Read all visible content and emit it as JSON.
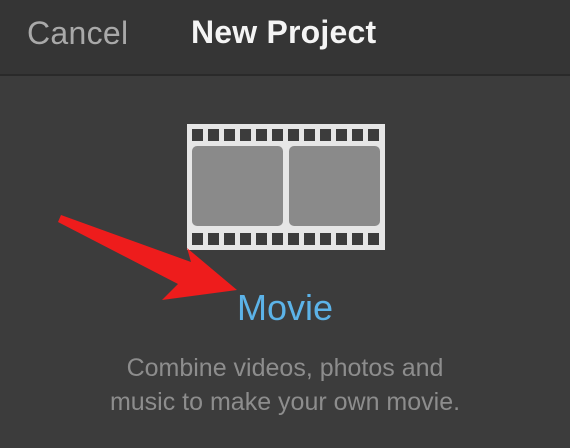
{
  "header": {
    "cancel_label": "Cancel",
    "title": "New Project"
  },
  "project_option": {
    "icon": "film-strip-icon",
    "label": "Movie",
    "description_line1": "Combine videos, photos and",
    "description_line2": "music to make your own movie."
  },
  "annotation": {
    "icon": "red-arrow-icon",
    "color": "#ee1c1c"
  },
  "colors": {
    "background": "#3c3c3c",
    "accent": "#5cb3e8",
    "title": "#f4f4f4",
    "muted": "#8d8d8d"
  }
}
